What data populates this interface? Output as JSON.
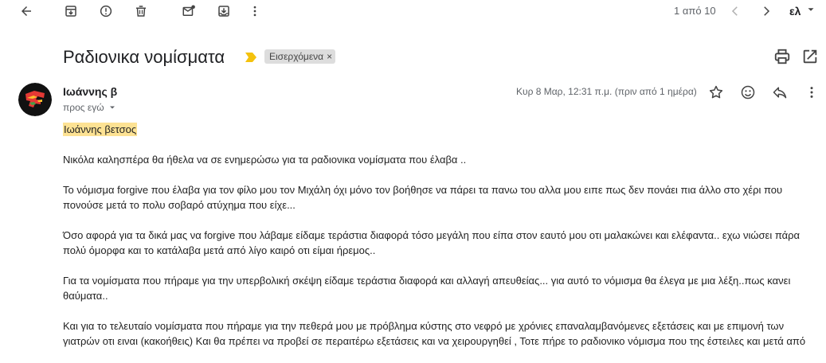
{
  "toolbar": {
    "pager": "1 από 10",
    "lang": "ελ"
  },
  "subject": {
    "title": "Ραδιονικα νομίσματα",
    "label": "Εισερχόμενα",
    "label_remove": "×"
  },
  "message": {
    "sender": "Ιωάννης β",
    "to": "προς εγώ",
    "date": "Κυρ 8 Μαρ, 12:31 π.μ. (πριν από 1 ημέρα)",
    "signature_highlight": "Ιωάννης βετσος",
    "paragraphs": [
      "Νικόλα καλησπέρα θα ήθελα να σε ενημερώσω για τα ραδιονικα νομίσματα που έλαβα ..",
      "Το νόμισμα forgive που έλαβα για τον φίλο μου τον Μιχάλη όχι μόνο τον βοήθησε να πάρει τα πανω του αλλα μου ειπε πως δεν πονάει πια άλλο στο χέρι που πονούσε μετά το πολυ σοβαρό ατύχημα που είχε...",
      "Όσο αφορά για τα δικά μας να forgive που λάβαμε είδαμε τεράστια διαφορά τόσο μεγάλη που είπα στον εαυτό μου οτι μαλακώνει και ελέφαντα.. εχω νιώσει πάρα πολύ όμορφα και το κατάλαβα μετά από λίγο καιρό οτι είμαι ήρεμος..",
      "Για τα νομίσματα που πήραμε για την υπερβολική σκέψη είδαμε τεράστια διαφορά και αλλαγή απευθείας... για αυτό το νόμισμα θα έλεγα με μια λέξη..πως κανει θαύματα..",
      "Και για το τελευταίο νομίσματα που πήραμε για την πεθερά μου με πρόβλημα κύστης στο νεφρό με χρόνιες επαναλαμβανόμενες εξετάσεις και με επιμονή των γιατρών οτι ειναι (κακοήθεις) Και θα πρέπει να προβεί σε περαιτέρω εξετάσεις και να χειρουργηθεί , Τοτε πήρε το ραδιονικο νόμισμα που της έστειλες και μετά από"
    ]
  },
  "icons": {
    "back": "arrow-left-icon",
    "archive": "archive-icon",
    "report": "report-spam-icon",
    "delete": "trash-icon",
    "mark_unread": "mark-unread-icon",
    "move": "move-to-icon",
    "more": "more-vert-icon"
  },
  "colors": {
    "highlight": "#fde293",
    "importance_marker": "#f4c20d",
    "chip_bg": "#dddddd"
  }
}
